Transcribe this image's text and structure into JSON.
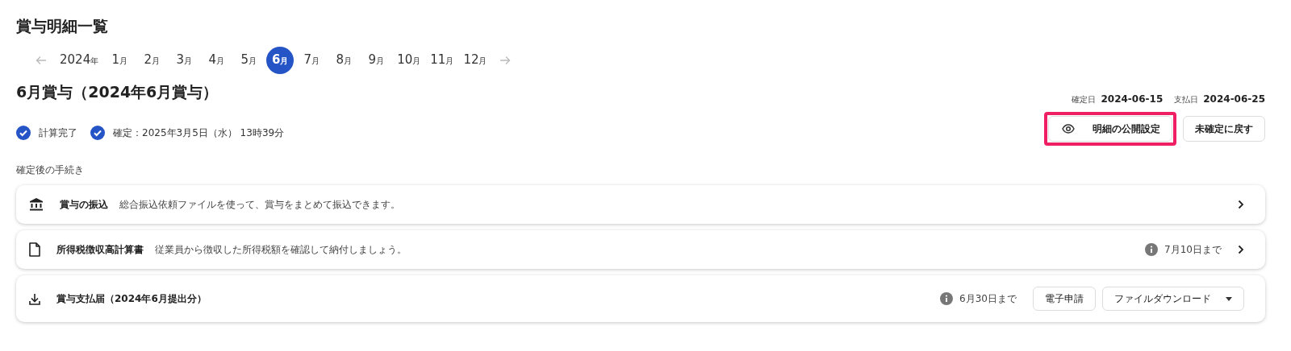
{
  "page_title": "賞与明細一覧",
  "period_nav": {
    "year": {
      "number": "2024",
      "unit": "年"
    },
    "months": [
      {
        "number": "1",
        "unit": "月",
        "selected": false
      },
      {
        "number": "2",
        "unit": "月",
        "selected": false
      },
      {
        "number": "3",
        "unit": "月",
        "selected": false
      },
      {
        "number": "4",
        "unit": "月",
        "selected": false
      },
      {
        "number": "5",
        "unit": "月",
        "selected": false
      },
      {
        "number": "6",
        "unit": "月",
        "selected": true
      },
      {
        "number": "7",
        "unit": "月",
        "selected": false
      },
      {
        "number": "8",
        "unit": "月",
        "selected": false
      },
      {
        "number": "9",
        "unit": "月",
        "selected": false
      },
      {
        "number": "10",
        "unit": "月",
        "selected": false
      },
      {
        "number": "11",
        "unit": "月",
        "selected": false
      },
      {
        "number": "12",
        "unit": "月",
        "selected": false
      }
    ]
  },
  "bonus_title": "6月賞与（2024年6月賞与）",
  "dates": [
    {
      "label": "確定日",
      "value": "2024-06-15"
    },
    {
      "label": "支払日",
      "value": "2024-06-25"
    }
  ],
  "statuses": [
    {
      "text": "計算完了",
      "checked": true
    },
    {
      "text": "確定：2025年3月5日（水） 13時39分",
      "checked": true
    }
  ],
  "actions": [
    {
      "label": "明細の公開設定",
      "highlighted": true
    },
    {
      "label": "未確定に戻す",
      "highlighted": false
    }
  ],
  "section_label": "確定後の手続き",
  "tasks": [
    {
      "title": "賞与の振込",
      "description": "総合振込依頼ファイルを使って、賞与をまとめて振込できます。",
      "kind": "link"
    },
    {
      "title": "所得税徴収高計算書",
      "description": "従業員から徴収した所得税額を確認して納付しましょう。",
      "deadline": "7月10日まで",
      "kind": "link"
    },
    {
      "title": "賞与支払届（2024年6月提出分）",
      "deadline": "6月30日まで",
      "kind": "buttons",
      "buttons": [
        {
          "label": "電子申請",
          "dropdown": false
        },
        {
          "label": "ファイルダウンロード",
          "dropdown": true
        }
      ]
    }
  ]
}
